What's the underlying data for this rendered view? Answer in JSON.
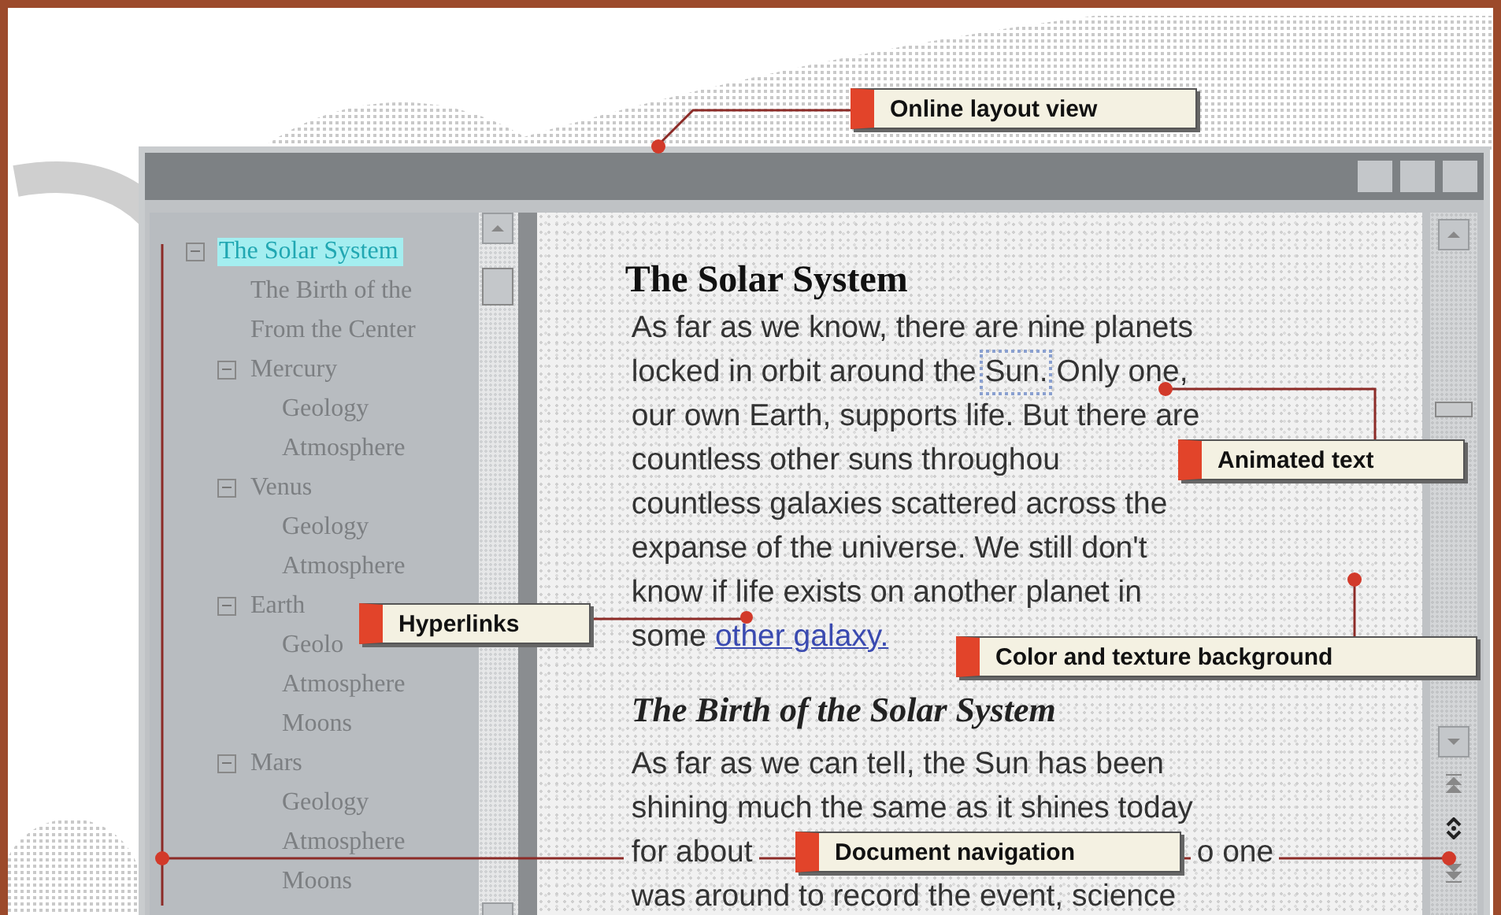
{
  "callouts": [
    {
      "text": "Online layout view"
    },
    {
      "text": "Animated text"
    },
    {
      "text": "Hyperlinks"
    },
    {
      "text": "Color and texture background"
    },
    {
      "text": "Document navigation"
    }
  ],
  "document_map": {
    "items": [
      {
        "label": "The Solar System",
        "selected": true,
        "expanded": true,
        "children": [
          {
            "label": "The Birth of the",
            "selected": false
          },
          {
            "label": "From the Center",
            "selected": false
          },
          {
            "label": "Mercury",
            "selected": false,
            "expanded": true,
            "children": [
              {
                "label": "Geology",
                "selected": false
              },
              {
                "label": "Atmosphere",
                "selected": false
              }
            ]
          },
          {
            "label": "Venus",
            "selected": false,
            "expanded": true,
            "children": [
              {
                "label": "Geology",
                "selected": false
              },
              {
                "label": "Atmosphere",
                "selected": false
              }
            ]
          },
          {
            "label": "Earth",
            "selected": false,
            "expanded": true,
            "children": [
              {
                "label": "Geolo",
                "selected": false
              },
              {
                "label": "Atmosphere",
                "selected": false
              },
              {
                "label": "Moons",
                "selected": false
              }
            ]
          },
          {
            "label": "Mars",
            "selected": false,
            "expanded": true,
            "children": [
              {
                "label": "Geology",
                "selected": false
              },
              {
                "label": "Atmosphere",
                "selected": false
              },
              {
                "label": "Moons",
                "selected": false
              }
            ]
          }
        ]
      }
    ]
  },
  "document": {
    "blocks": [
      {
        "kind": "heading",
        "text": "The Solar System"
      },
      {
        "kind": "paragraph",
        "lines": [
          [
            {
              "kind": "plain",
              "text": "As far as we know, there are nine planets"
            }
          ],
          [
            {
              "kind": "plain",
              "text": "locked in orbit around the "
            },
            {
              "kind": "animated",
              "text": "Sun."
            },
            {
              "kind": "plain",
              "text": " Only one,"
            }
          ],
          [
            {
              "kind": "plain",
              "text": "our own Earth, supports life. But there are"
            }
          ],
          [
            {
              "kind": "plain",
              "text": "countless other suns throughou"
            }
          ],
          [
            {
              "kind": "plain",
              "text": "countless galaxies scattered across the"
            }
          ],
          [
            {
              "kind": "plain",
              "text": "expanse of the universe. We still don't"
            }
          ],
          [
            {
              "kind": "plain",
              "text": "know if life exists on another planet in"
            }
          ],
          [
            {
              "kind": "plain",
              "text": "some "
            },
            {
              "kind": "link",
              "text": "other galaxy."
            }
          ]
        ]
      },
      {
        "kind": "subheading",
        "text": "The Birth of the Solar System"
      },
      {
        "kind": "paragraph",
        "lines": [
          [
            {
              "kind": "plain",
              "text": "As far as we can tell, the Sun has been"
            }
          ],
          [
            {
              "kind": "plain",
              "text": "shining much the same as it shines today"
            }
          ],
          [
            {
              "kind": "plain",
              "text": "for about"
            },
            {
              "kind": "resumed",
              "text": "o one"
            }
          ],
          [
            {
              "kind": "plain",
              "text": "was around to record the event, science"
            }
          ]
        ]
      }
    ]
  }
}
